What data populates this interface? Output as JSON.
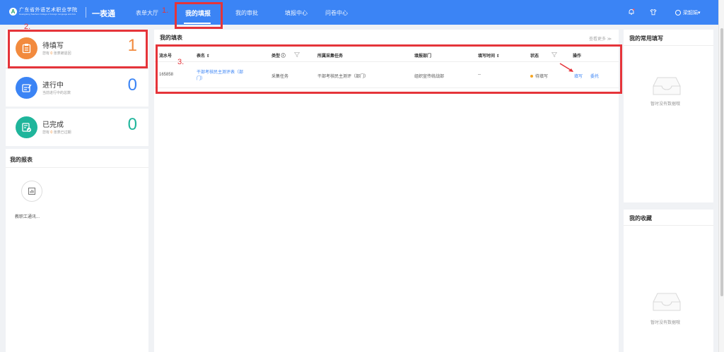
{
  "header": {
    "org_name": "广东省外语艺术职业学院",
    "org_sub": "Guangdong Teachers College of Foreign Language and Arts",
    "brand": "一表通",
    "nav": [
      "表单大厅",
      "我的填报",
      "我的审批",
      "填报中心",
      "问卷中心"
    ],
    "user": "梁韶娟▾"
  },
  "annotations": [
    "1.",
    "2.",
    "3."
  ],
  "stats": [
    {
      "title": "待填写",
      "sub_pre": "您有",
      "sub_num": "0",
      "sub_post": "张表被退回",
      "count": "1",
      "color": "#f28a3e"
    },
    {
      "title": "进行中",
      "sub": "当前进行中的总数",
      "count": "0",
      "color": "#3b84f5"
    },
    {
      "title": "已完成",
      "sub_pre": "您有",
      "sub_num": "0",
      "sub_post": "张表已过期",
      "count": "0",
      "color": "#1fb59b"
    }
  ],
  "reports": {
    "title": "我的报表",
    "item_label": "教职工通讯..."
  },
  "fill_panel": {
    "title": "我的填表",
    "view_more": "查看更多 ≫",
    "headers": [
      "流水号",
      "表名 ⇕",
      "类型 ⓘ",
      "所属采集任务",
      "填报部门",
      "填写时间 ⇕",
      "状态",
      "操作"
    ],
    "row": {
      "id": "165858",
      "name_line1": "干部考核民主测评表（部",
      "name_line2": "门）",
      "type": "采集任务",
      "task": "干部考核民主测评（部门）",
      "dept": "组织宣传统战部",
      "time": "--",
      "status": "待填写",
      "action_fill": "填写",
      "action_delegate": "委托"
    }
  },
  "common_panel": {
    "title": "我的常用填写",
    "empty": "暂时没有数据哦"
  },
  "fav_panel": {
    "title": "我的收藏",
    "empty": "暂时没有数据哦"
  }
}
